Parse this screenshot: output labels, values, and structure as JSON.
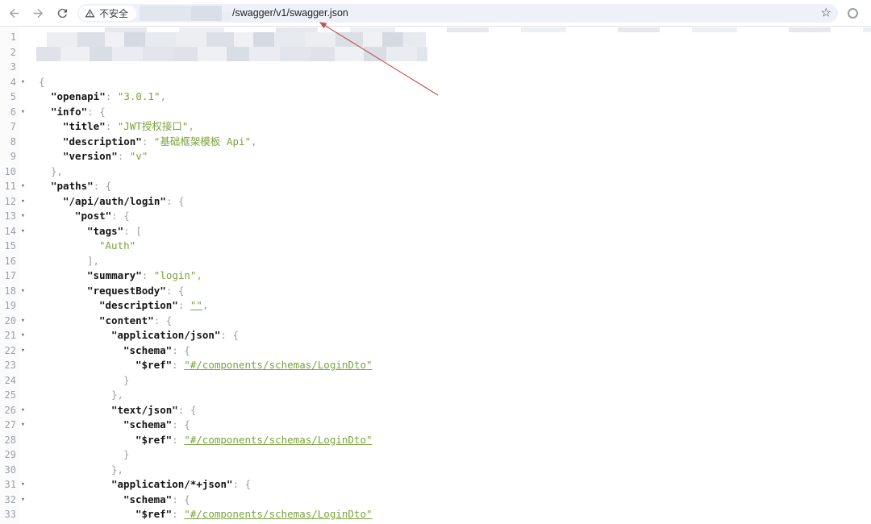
{
  "browser": {
    "security_label": "不安全",
    "url_path": "/swagger/v1/swagger.json",
    "bookmark_star": "☆",
    "accent_colors": {
      "omnibox_bg": "#eef1f8",
      "icon_gray": "#5f6368",
      "json_green": "#7aa33c",
      "annotation_red": "#c0544e"
    }
  },
  "viewer": {
    "lines": [
      {
        "n": 1,
        "blur": true
      },
      {
        "n": 2,
        "blur": true
      },
      {
        "n": 3,
        "i": 0,
        "seg": []
      },
      {
        "n": 4,
        "a": 1,
        "i": 0,
        "seg": [
          [
            "p",
            "{"
          ]
        ]
      },
      {
        "n": 5,
        "i": 1,
        "seg": [
          [
            "k",
            "\"openapi\""
          ],
          [
            "p",
            ": "
          ],
          [
            "s",
            "\"3.0.1\""
          ],
          [
            "p",
            ","
          ]
        ]
      },
      {
        "n": 6,
        "a": 1,
        "i": 1,
        "seg": [
          [
            "k",
            "\"info\""
          ],
          [
            "p",
            ": {"
          ]
        ]
      },
      {
        "n": 7,
        "i": 2,
        "seg": [
          [
            "k",
            "\"title\""
          ],
          [
            "p",
            ": "
          ],
          [
            "s",
            "\"JWT授权接口\""
          ],
          [
            "p",
            ","
          ]
        ]
      },
      {
        "n": 8,
        "i": 2,
        "seg": [
          [
            "k",
            "\"description\""
          ],
          [
            "p",
            ": "
          ],
          [
            "s",
            "\"基础框架模板 Api\""
          ],
          [
            "p",
            ","
          ]
        ]
      },
      {
        "n": 9,
        "i": 2,
        "seg": [
          [
            "k",
            "\"version\""
          ],
          [
            "p",
            ": "
          ],
          [
            "s",
            "\"v\""
          ]
        ]
      },
      {
        "n": 10,
        "i": 1,
        "seg": [
          [
            "p",
            "},"
          ]
        ]
      },
      {
        "n": 11,
        "a": 1,
        "i": 1,
        "seg": [
          [
            "k",
            "\"paths\""
          ],
          [
            "p",
            ": {"
          ]
        ]
      },
      {
        "n": 12,
        "a": 1,
        "i": 2,
        "seg": [
          [
            "k",
            "\"/api/auth/login\""
          ],
          [
            "p",
            ": {"
          ]
        ]
      },
      {
        "n": 13,
        "a": 1,
        "i": 3,
        "seg": [
          [
            "k",
            "\"post\""
          ],
          [
            "p",
            ": {"
          ]
        ]
      },
      {
        "n": 14,
        "a": 1,
        "i": 4,
        "seg": [
          [
            "k",
            "\"tags\""
          ],
          [
            "p",
            ": ["
          ]
        ]
      },
      {
        "n": 15,
        "i": 5,
        "seg": [
          [
            "s",
            "\"Auth\""
          ]
        ]
      },
      {
        "n": 16,
        "i": 4,
        "seg": [
          [
            "p",
            "],"
          ]
        ]
      },
      {
        "n": 17,
        "i": 4,
        "seg": [
          [
            "k",
            "\"summary\""
          ],
          [
            "p",
            ": "
          ],
          [
            "s",
            "\"login\""
          ],
          [
            "p",
            ","
          ]
        ]
      },
      {
        "n": 18,
        "a": 1,
        "i": 4,
        "seg": [
          [
            "k",
            "\"requestBody\""
          ],
          [
            "p",
            ": {"
          ]
        ]
      },
      {
        "n": 19,
        "i": 5,
        "seg": [
          [
            "k",
            "\"description\""
          ],
          [
            "p",
            ": "
          ],
          [
            "l",
            "\"\""
          ],
          [
            "p",
            ","
          ]
        ]
      },
      {
        "n": 20,
        "a": 1,
        "i": 5,
        "seg": [
          [
            "k",
            "\"content\""
          ],
          [
            "p",
            ": {"
          ]
        ]
      },
      {
        "n": 21,
        "a": 1,
        "i": 6,
        "seg": [
          [
            "k",
            "\"application/json\""
          ],
          [
            "p",
            ": {"
          ]
        ]
      },
      {
        "n": 22,
        "a": 1,
        "i": 7,
        "seg": [
          [
            "k",
            "\"schema\""
          ],
          [
            "p",
            ": {"
          ]
        ]
      },
      {
        "n": 23,
        "i": 8,
        "seg": [
          [
            "k",
            "\"$ref\""
          ],
          [
            "p",
            ": "
          ],
          [
            "l",
            "\"#/components/schemas/LoginDto\""
          ]
        ]
      },
      {
        "n": 24,
        "i": 7,
        "seg": [
          [
            "p",
            "}"
          ]
        ]
      },
      {
        "n": 25,
        "i": 6,
        "seg": [
          [
            "p",
            "},"
          ]
        ]
      },
      {
        "n": 26,
        "a": 1,
        "i": 6,
        "seg": [
          [
            "k",
            "\"text/json\""
          ],
          [
            "p",
            ": {"
          ]
        ]
      },
      {
        "n": 27,
        "a": 1,
        "i": 7,
        "seg": [
          [
            "k",
            "\"schema\""
          ],
          [
            "p",
            ": {"
          ]
        ]
      },
      {
        "n": 28,
        "i": 8,
        "seg": [
          [
            "k",
            "\"$ref\""
          ],
          [
            "p",
            ": "
          ],
          [
            "l",
            "\"#/components/schemas/LoginDto\""
          ]
        ]
      },
      {
        "n": 29,
        "i": 7,
        "seg": [
          [
            "p",
            "}"
          ]
        ]
      },
      {
        "n": 30,
        "i": 6,
        "seg": [
          [
            "p",
            "},"
          ]
        ]
      },
      {
        "n": 31,
        "a": 1,
        "i": 6,
        "seg": [
          [
            "k",
            "\"application/*+json\""
          ],
          [
            "p",
            ": {"
          ]
        ]
      },
      {
        "n": 32,
        "a": 1,
        "i": 7,
        "seg": [
          [
            "k",
            "\"schema\""
          ],
          [
            "p",
            ": {"
          ]
        ]
      },
      {
        "n": 33,
        "i": 8,
        "seg": [
          [
            "k",
            "\"$ref\""
          ],
          [
            "p",
            ": "
          ],
          [
            "l",
            "\"#/components/schemas/LoginDto\""
          ]
        ]
      }
    ]
  }
}
